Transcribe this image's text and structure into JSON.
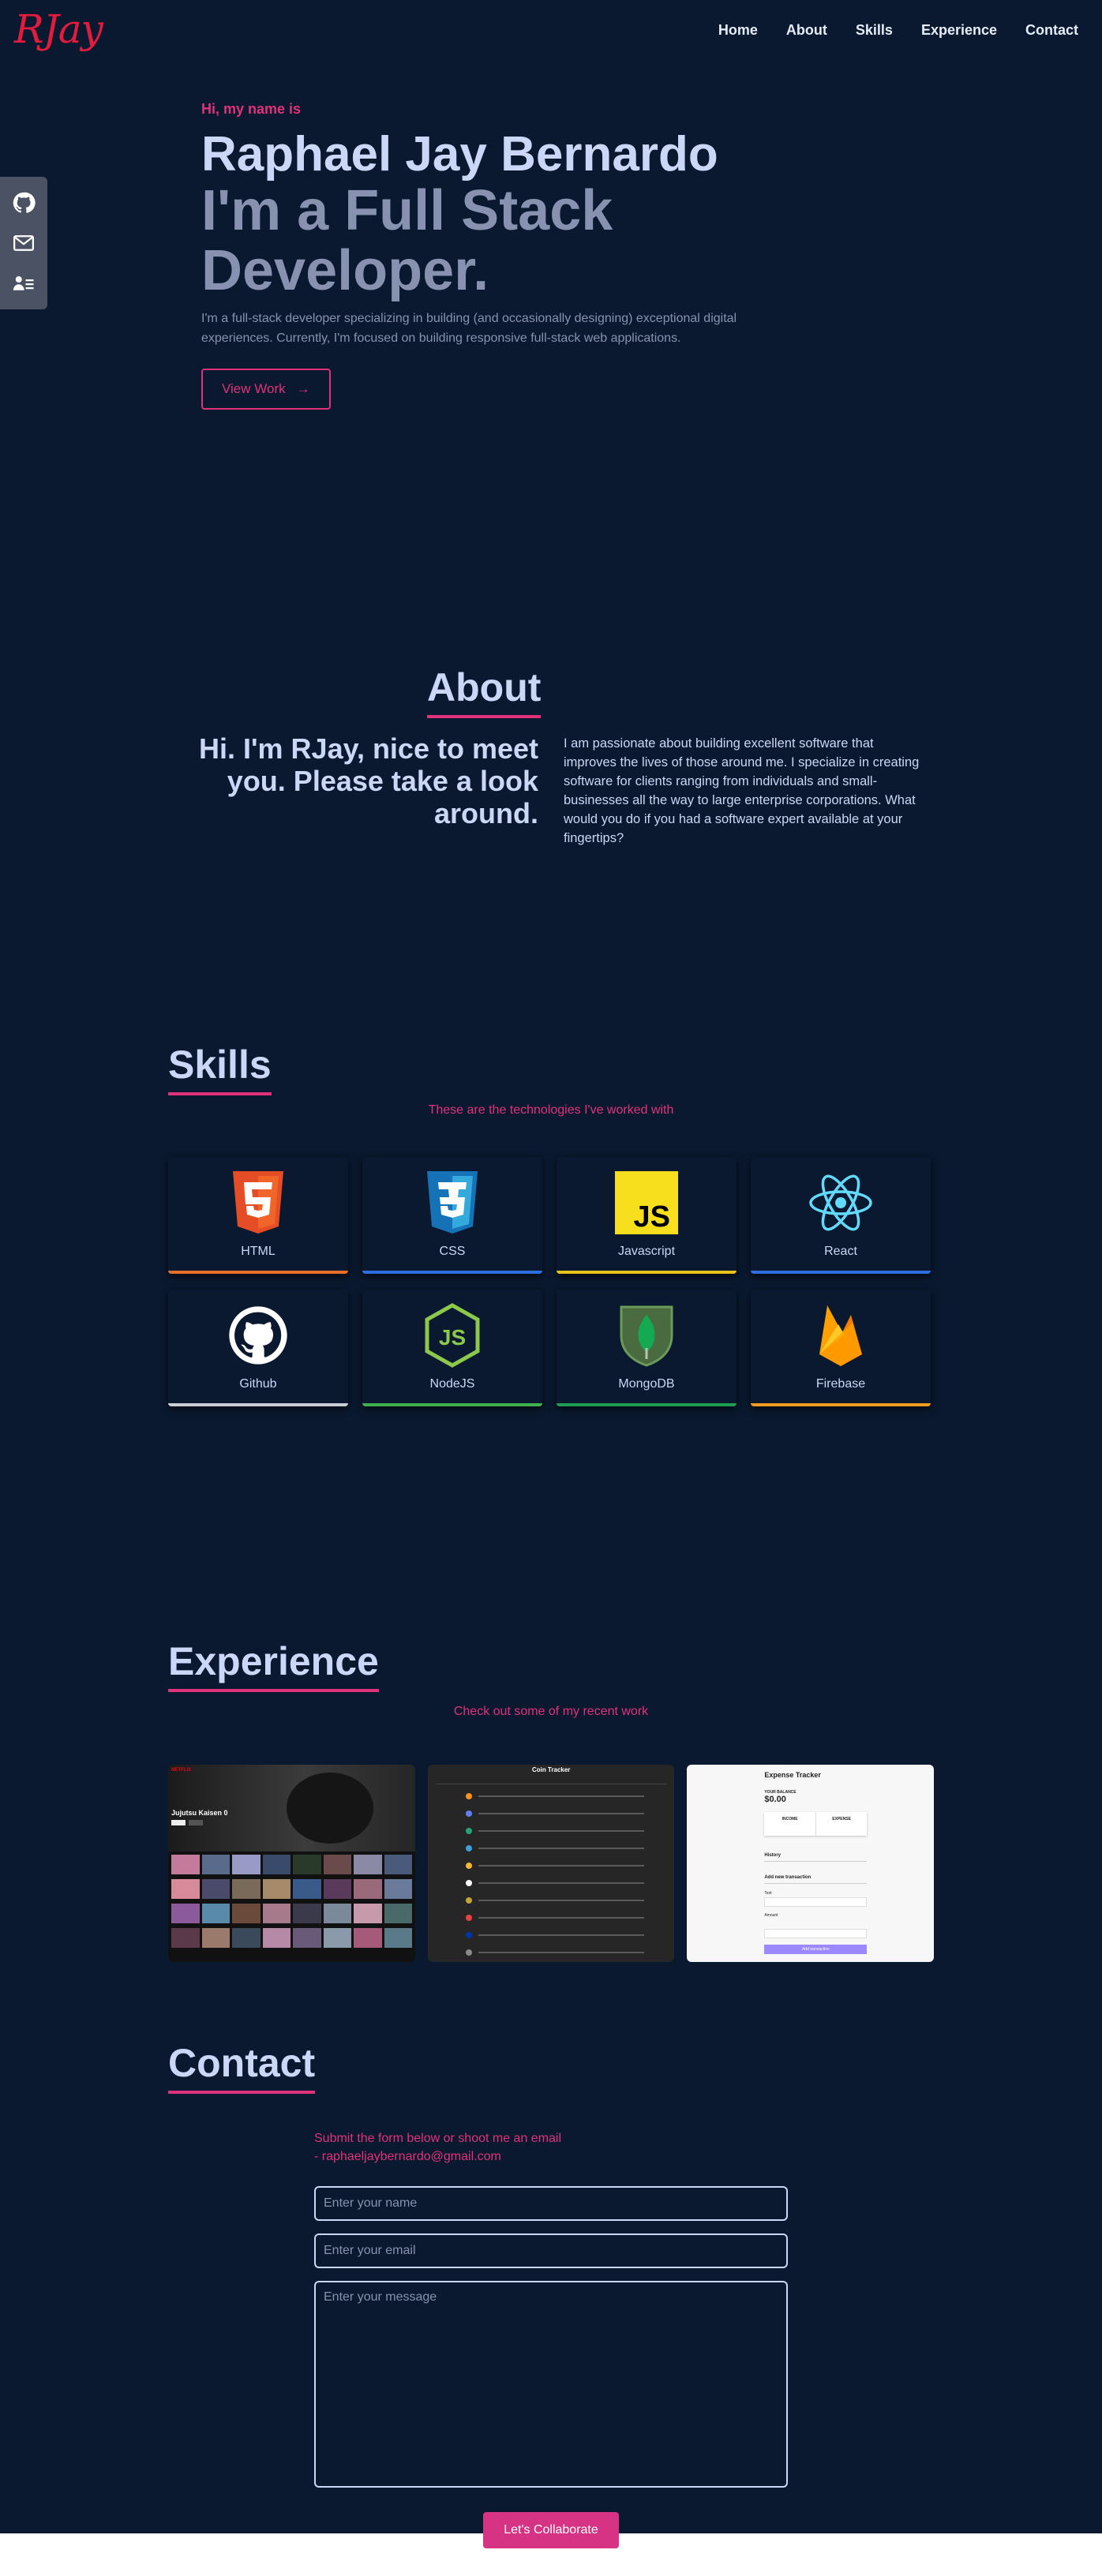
{
  "brand": {
    "logo": "RJay"
  },
  "nav": {
    "items": [
      "Home",
      "About",
      "Skills",
      "Experience",
      "Contact"
    ]
  },
  "social": {
    "icons": [
      "github-icon",
      "mail-icon",
      "contact-card-icon"
    ]
  },
  "hero": {
    "greeting": "Hi, my name is",
    "name": "Raphael Jay Bernardo",
    "role_line1": "I'm a Full Stack",
    "role_line2": "Developer.",
    "description": "I'm a full-stack developer specializing in building (and occasionally designing) exceptional digital experiences. Currently, I'm focused on building responsive full-stack web applications.",
    "cta": "View Work"
  },
  "about": {
    "title": "About",
    "lead": "Hi. I'm RJay, nice to meet you. Please take a look around.",
    "text": "I am passionate about building excellent software that improves the lives of those around me. I specialize in creating software for clients ranging from individuals and small-businesses all the way to large enterprise corporations. What would you do if you had a software expert available at your fingertips?"
  },
  "skills": {
    "title": "Skills",
    "subtitle": "These are the technologies I've worked with",
    "items": [
      {
        "label": "HTML",
        "color": "#e76f2c"
      },
      {
        "label": "CSS",
        "color": "#2d6fe0"
      },
      {
        "label": "Javascript",
        "color": "#e6c31b"
      },
      {
        "label": "React",
        "color": "#2d6fe0"
      },
      {
        "label": "Github",
        "color": "#c9ced6"
      },
      {
        "label": "NodeJS",
        "color": "#3fb24f"
      },
      {
        "label": "MongoDB",
        "color": "#1f9e52"
      },
      {
        "label": "Firebase",
        "color": "#f29c1f"
      }
    ]
  },
  "experience": {
    "title": "Experience",
    "subtitle": "Check out some of my recent work",
    "works": [
      {
        "caption": "Jujutsu Kaisen 0"
      },
      {
        "caption": "Coin Tracker"
      },
      {
        "caption": "Expense Tracker",
        "balance_label": "YOUR BALANCE",
        "balance": "$0.00",
        "income": "INCOME",
        "expense": "EXPENSE",
        "history": "History",
        "add": "Add new transaction",
        "text": "Text",
        "amount": "Amount",
        "button": "Add transaction"
      }
    ]
  },
  "contact": {
    "title": "Contact",
    "subtitle_line1": "Submit the form below or shoot me an email",
    "subtitle_line2": "- raphaeljaybernardo@gmail.com",
    "name_placeholder": "Enter your name",
    "email_placeholder": "Enter your email",
    "message_placeholder": "Enter your message",
    "submit": "Let's Collaborate"
  }
}
